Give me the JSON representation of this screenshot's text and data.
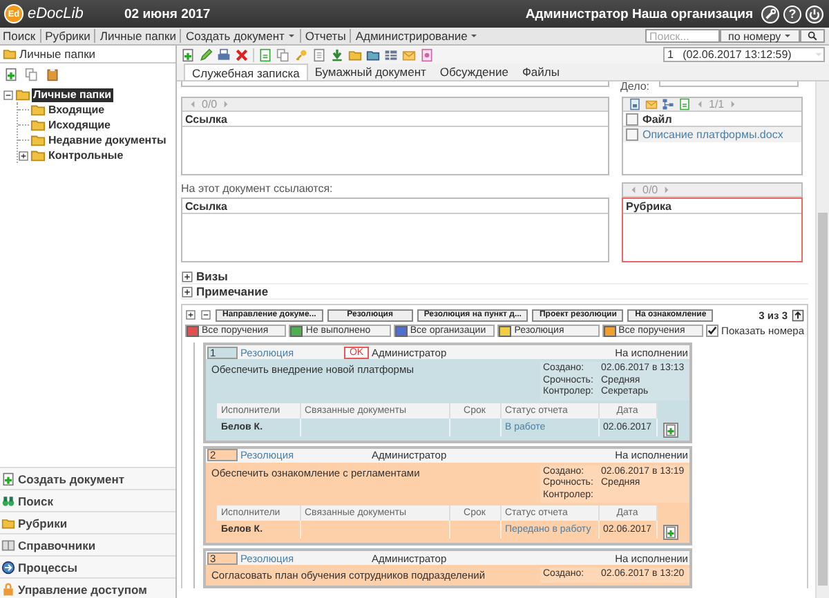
{
  "header": {
    "logo_mark": "Ed",
    "app_name": "eDocLib",
    "date": "02 июня 2017",
    "user": "Администратор Наша организация",
    "help_label": "?"
  },
  "menu": {
    "items": [
      {
        "label": "Поиск",
        "dropdown": false
      },
      {
        "label": "Рубрики",
        "dropdown": false
      },
      {
        "label": "Личные папки",
        "dropdown": false
      },
      {
        "label": "Создать документ",
        "dropdown": true
      },
      {
        "label": "Отчеты",
        "dropdown": false
      },
      {
        "label": "Администрирование",
        "dropdown": true
      }
    ],
    "search": {
      "placeholder": "Поиск...",
      "mode": "по номеру"
    }
  },
  "sidebar": {
    "title": "Личные папки",
    "tree": [
      {
        "label": "Личные папки",
        "selected": true,
        "expanded": true,
        "children": [
          {
            "label": "Входящие",
            "selected": false
          },
          {
            "label": "Исходящие",
            "selected": false
          },
          {
            "label": "Недавние документы",
            "selected": false
          },
          {
            "label": "Контрольные",
            "selected": false,
            "expanded": false
          }
        ]
      }
    ],
    "nav": [
      "Создать документ",
      "Поиск",
      "Рубрики",
      "Справочники",
      "Процессы",
      "Управление доступом"
    ]
  },
  "document": {
    "version": "1   (02.06.2017 13:12:59)",
    "tabs": [
      {
        "label": "Служебная записка",
        "selected": true
      },
      {
        "label": "Бумажный документ",
        "selected": false
      },
      {
        "label": "Обсуждение",
        "selected": false
      },
      {
        "label": "Файлы",
        "selected": false
      }
    ],
    "case_label": "Дело:",
    "links": {
      "pager": "0/0",
      "column": "Ссылка"
    },
    "files": {
      "pager": "1/1",
      "column": "Файл",
      "header_checked": false,
      "rows": [
        {
          "name": "Описание платформы.docx",
          "checked": false
        }
      ]
    },
    "backlinks_label": "На этот документ ссылаются:",
    "backlinks": {
      "column": "Ссылка"
    },
    "rubrics": {
      "pager": "0/0",
      "column": "Рубрика",
      "invalid": true
    },
    "sections": [
      {
        "label": "Визы",
        "expanded": false
      },
      {
        "label": "Примечание",
        "expanded": false
      }
    ]
  },
  "tasks": {
    "filter_buttons": [
      "Направление докуме...",
      "Резолюция",
      "Резолюция на пункт д...",
      "Проект резолюции",
      "На ознакомление"
    ],
    "counter": "3 из 3",
    "color_filters": [
      {
        "label": "Все поручения",
        "color": "#e05050"
      },
      {
        "label": "Не выполнено",
        "color": "#50b050"
      },
      {
        "label": "Все организации",
        "color": "#5070d0"
      },
      {
        "label": "Резолюция",
        "color": "#f0d040"
      },
      {
        "label": "Все поручения",
        "color": "#f0a030"
      }
    ],
    "show_numbers": {
      "label": "Показать номера",
      "checked": true
    },
    "cards": [
      {
        "number": "1",
        "type": "Резолюция",
        "badge": "OK",
        "author": "Администратор",
        "status": "На исполнении",
        "color": "#c9dfe3",
        "text": "Обеспечить внедрение новой платформы",
        "meta": [
          {
            "label": "Создано:",
            "value": "02.06.2017 в 13:13"
          },
          {
            "label": "Срочность:",
            "value": "Средняя"
          },
          {
            "label": "Контролер:",
            "value": "Секретарь"
          }
        ],
        "columns": [
          "Исполнители",
          "Связанные документы",
          "Срок",
          "Статус отчета",
          "Дата"
        ],
        "rows": [
          {
            "performer": "Белов К.",
            "report_status": "В работе",
            "date": "02.06.2017"
          }
        ]
      },
      {
        "number": "2",
        "type": "Резолюция",
        "author": "Администратор",
        "status": "На исполнении",
        "color": "#fdd0aa",
        "text": "Обеспечить ознакомление с регламентами",
        "meta": [
          {
            "label": "Создано:",
            "value": "02.06.2017 в 13:19"
          },
          {
            "label": "Срочность:",
            "value": "Средняя"
          },
          {
            "label": "Контролер:"
          }
        ],
        "columns": [
          "Исполнители",
          "Связанные документы",
          "Срок",
          "Статус отчета",
          "Дата"
        ],
        "rows": [
          {
            "performer": "Белов К.",
            "report_status": "Передано в работу",
            "date": "02.06.2017"
          }
        ]
      },
      {
        "number": "3",
        "type": "Резолюция",
        "author": "Администратор",
        "status": "На исполнении",
        "color": "#fdd0aa",
        "text": "Согласовать план обучения сотрудников подразделений",
        "meta": [
          {
            "label": "Создано:",
            "value": "02.06.2017 в 13:20"
          }
        ]
      }
    ]
  }
}
